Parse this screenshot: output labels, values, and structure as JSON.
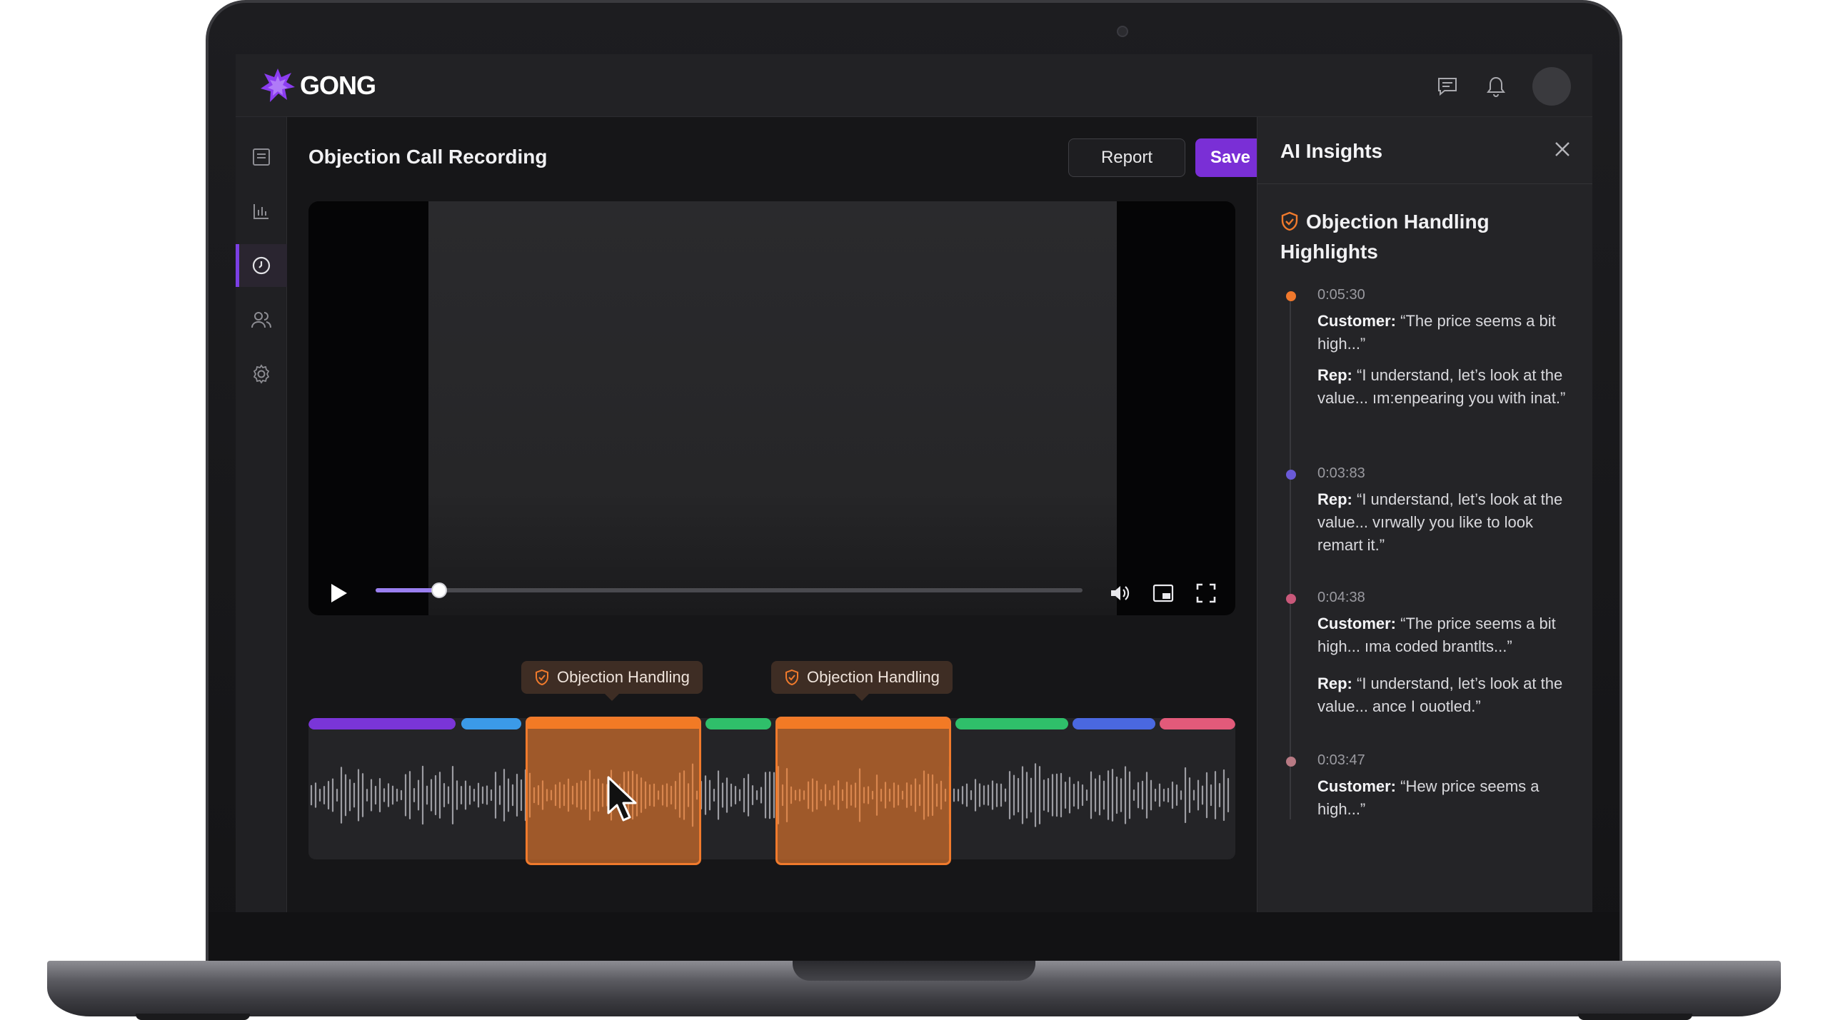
{
  "app": {
    "logo_text": "GONG"
  },
  "page": {
    "title": "Objection Call Recording"
  },
  "toolbar": {
    "report_label": "Report",
    "save_label": "Save"
  },
  "topbar": {
    "icons": [
      "chat-icon",
      "bell-icon",
      "avatar"
    ]
  },
  "sidebar": {
    "items": [
      "document-icon",
      "chart-icon",
      "clock-icon",
      "users-icon",
      "gear-icon"
    ],
    "active_index": 2
  },
  "player": {
    "progress_fraction": 0.09,
    "controls": [
      "play-icon",
      "volume-icon",
      "picture-in-picture-icon",
      "fullscreen-icon"
    ]
  },
  "timeline": {
    "tags": [
      {
        "label": "Objection Handling"
      },
      {
        "label": "Objection Handling"
      }
    ],
    "segment_colors": [
      "#7a35d8",
      "#3b9ae8",
      "#e8772e",
      "#2fbf6a",
      "#e8772e",
      "#2fbf6a",
      "#4a68e0",
      "#e25a7a"
    ],
    "highlight_color": "#f07a2c"
  },
  "insights": {
    "title": "AI Insights",
    "section_title": "Objection Handling Highlights",
    "entries": [
      {
        "time": "0:05:30",
        "dot_color": "#f0782c",
        "lines": [
          {
            "speaker": "Customer:",
            "text": " “The price seems a bit high...”"
          },
          {
            "speaker": "Rep:",
            "text": " “I understand, let’s look at the value... ım:enpearing you with inat.”"
          }
        ]
      },
      {
        "time": "0:03:83",
        "dot_color": "#6a5ad8",
        "lines": [
          {
            "speaker": "Rep:",
            "text": " “I understand, let’s look at the value... vırwally you like to look remart it.”"
          }
        ]
      },
      {
        "time": "0:04:38",
        "dot_color": "#c9587a",
        "lines": [
          {
            "speaker": "Customer:",
            "text": " “The price seems a bit high... ıma coded brantlts...”"
          },
          {
            "speaker": "Rep:",
            "text": " “I understand, let’s look at the value... ance I ouotled.”"
          }
        ]
      },
      {
        "time": "0:03:47",
        "dot_color": "#b87a84",
        "lines": [
          {
            "speaker": "Customer:",
            "text": " “Hew price seems a high...”"
          }
        ]
      }
    ]
  }
}
